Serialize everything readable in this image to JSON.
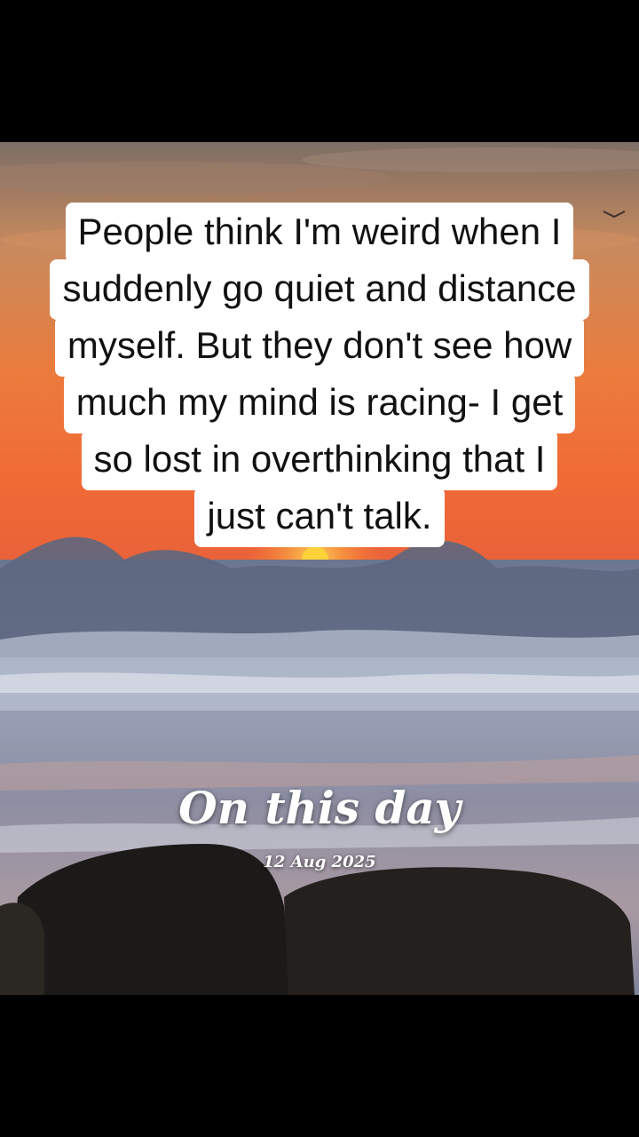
{
  "quote": {
    "lines": [
      "People think I'm weird when I",
      "suddenly go quiet and distance",
      "myself. But they don't see how",
      "much my mind is racing- I get",
      "so lost in overthinking that I",
      "just can't talk."
    ]
  },
  "memory": {
    "title": "On this day",
    "date": "12 Aug 2025"
  },
  "colors": {
    "sky_top": "#8a7565",
    "sky_orange": "#f07a3a",
    "sun": "#ffd23a",
    "sea": "#7f8aa3",
    "rock": "#1c1a19"
  }
}
